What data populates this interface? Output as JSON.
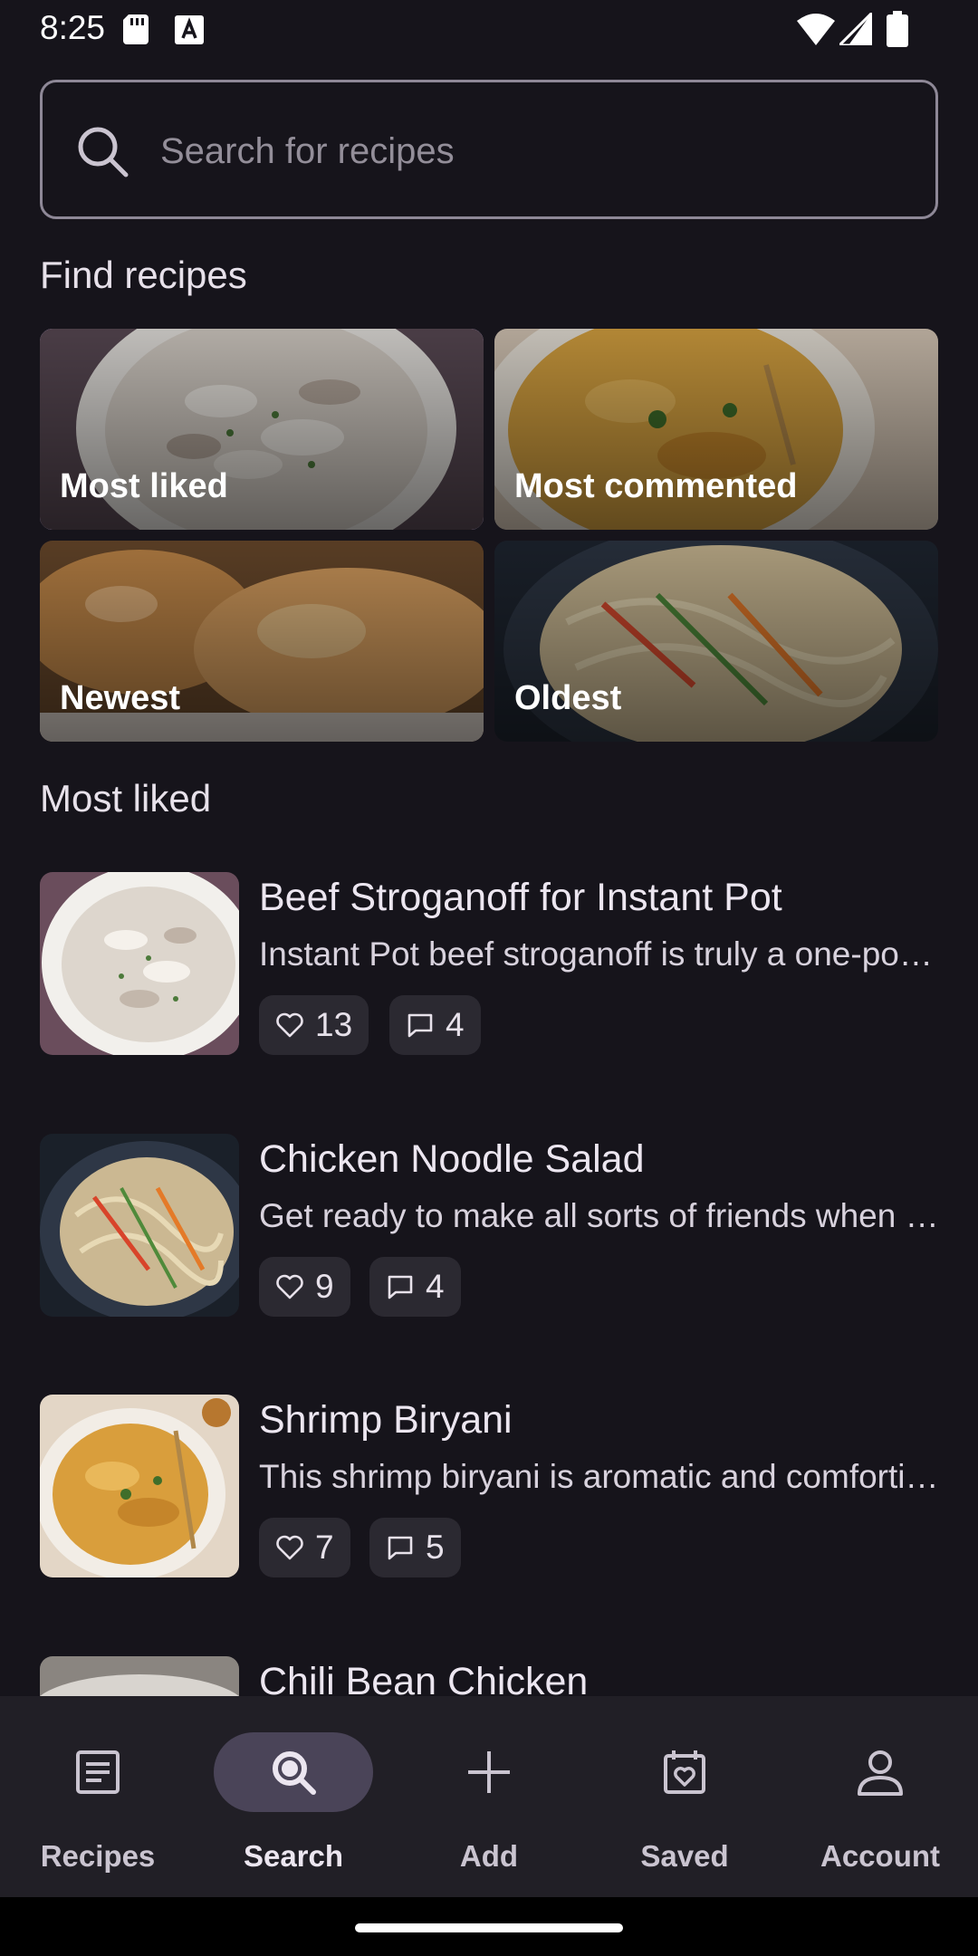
{
  "status_bar": {
    "time": "8:25"
  },
  "search": {
    "placeholder": "Search for recipes"
  },
  "find_section": {
    "title": "Find recipes",
    "categories": [
      {
        "label": "Most liked",
        "selected": true
      },
      {
        "label": "Most commented",
        "selected": false
      },
      {
        "label": "Newest",
        "selected": false
      },
      {
        "label": "Oldest",
        "selected": false
      }
    ]
  },
  "list_section": {
    "title": "Most liked",
    "recipes": [
      {
        "title": "Beef Stroganoff for Instant Pot",
        "description": "Instant Pot beef stroganoff is truly a one-pot wonder that's perfect for a busy weeknight dinner.",
        "likes": "13",
        "comments": "4"
      },
      {
        "title": "Chicken Noodle Salad",
        "description": "Get ready to make all sorts of friends when you bring this noodle salad to the party.",
        "likes": "9",
        "comments": "4"
      },
      {
        "title": "Shrimp Biryani",
        "description": "This shrimp biryani is aromatic and comforting with layers of spiced rice.",
        "likes": "7",
        "comments": "5"
      },
      {
        "title": "Chili Bean Chicken"
      }
    ]
  },
  "bottom_nav": {
    "items": [
      {
        "label": "Recipes",
        "icon": "article-icon",
        "active": false
      },
      {
        "label": "Search",
        "icon": "search-icon",
        "active": true
      },
      {
        "label": "Add",
        "icon": "plus-icon",
        "active": false
      },
      {
        "label": "Saved",
        "icon": "calendar-heart-icon",
        "active": false
      },
      {
        "label": "Account",
        "icon": "person-icon",
        "active": false
      }
    ]
  },
  "colors": {
    "background": "#16141b",
    "nav_background": "#211f26",
    "active_pill": "#4a4458",
    "chip_background": "#2b2931",
    "selected_outline": "#c8b8ee"
  }
}
